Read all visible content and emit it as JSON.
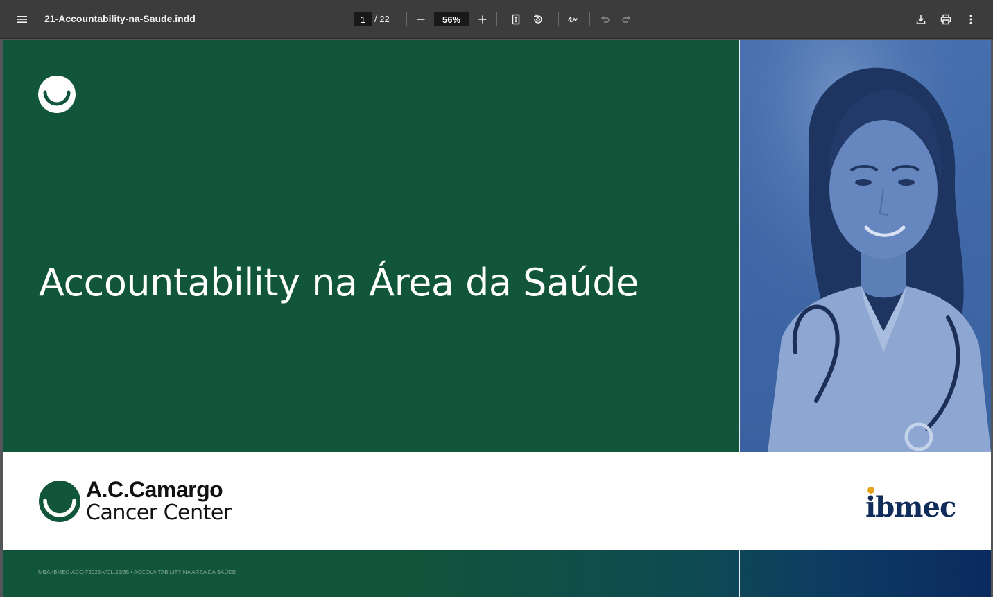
{
  "toolbar": {
    "menu_icon": "hamburger-menu-icon",
    "document_title": "21-Accountability-na-Saude.indd",
    "current_page": "1",
    "page_separator": "/ 22",
    "zoom": "56%",
    "icons": [
      "minus-icon",
      "plus-icon",
      "fit-page-icon",
      "rotate-icon",
      "draw-icon",
      "undo-icon",
      "redo-icon",
      "download-icon",
      "print-icon",
      "more-vert-icon"
    ]
  },
  "page": {
    "title": "Accountability na Área da Saúde",
    "brand_name": "A.C.Camargo",
    "brand_sub": "Cancer Center",
    "partner_logo": "ibmec",
    "footer": "MBA-IBMEC-ACC-T2025-VOL.22/35 • ACCOUNTABILITY NA AREA DA SAÚDE",
    "colors": {
      "green": "#11553a",
      "photo_blue": "#3f67a5",
      "navy": "#0f2c5a",
      "gold": "#e5a21a"
    }
  }
}
